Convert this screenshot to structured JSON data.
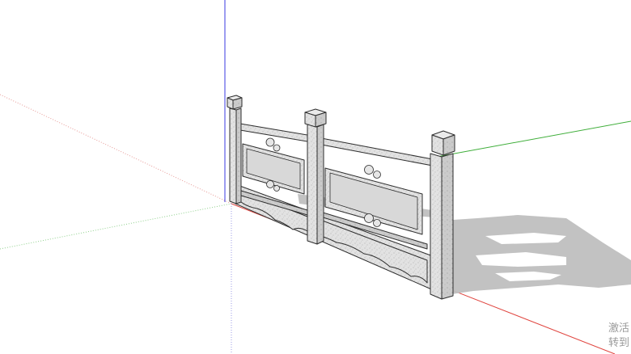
{
  "viewport": {
    "background": "#ffffff",
    "axis_colors": {
      "red": "#e0443e",
      "green": "#3fae3a",
      "blue": "#3a3ae0"
    },
    "model_colors": {
      "stone_light": "#e4e4e4",
      "stone_mid": "#c9c9c9",
      "stone_dark": "#a9a9a9",
      "edge": "#2e2e2e",
      "shadow": "#bdbdbd"
    },
    "model": "stone-balustrade"
  },
  "watermark": {
    "line1": "激活",
    "line2": "转到"
  }
}
